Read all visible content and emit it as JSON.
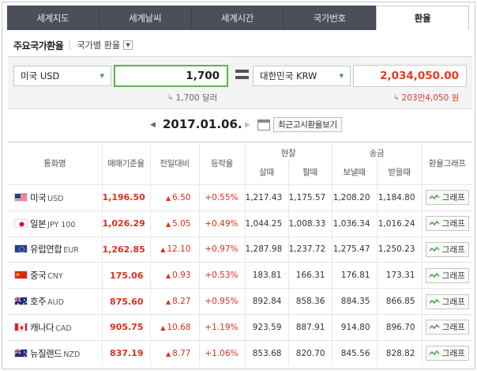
{
  "tabs": [
    {
      "label": "세계지도",
      "active": false
    },
    {
      "label": "세계날씨",
      "active": false
    },
    {
      "label": "세계시간",
      "active": false
    },
    {
      "label": "국가번호",
      "active": false
    },
    {
      "label": "환율",
      "active": true
    }
  ],
  "subtabs": {
    "active": "주요국가환율",
    "other": "국가별 환율"
  },
  "converter": {
    "from_currency": "미국 USD",
    "from_amount": "1,700",
    "from_hint": "1,700 달러",
    "to_currency": "대한민국 KRW",
    "to_amount": "2,034,050.00",
    "to_hint": "203만4,050 원"
  },
  "date": "2017.01.06.",
  "recent_button": "최근고시환율보기",
  "table": {
    "headers": {
      "currency": "통화명",
      "base": "매매기준율",
      "change": "전일대비",
      "rate": "등락율",
      "cash": "현찰",
      "cash_buy": "살때",
      "cash_sell": "팔때",
      "remit": "송금",
      "remit_send": "보낼때",
      "remit_recv": "받을때",
      "graph": "환율그래프"
    },
    "graph_label": "그래프",
    "rows": [
      {
        "name": "미국",
        "code": "USD",
        "flag": "us",
        "base": "1,196.50",
        "change": "6.50",
        "rate": "+0.55%",
        "cash_buy": "1,217.43",
        "cash_sell": "1,175.57",
        "send": "1,208.20",
        "recv": "1,184.80"
      },
      {
        "name": "일본",
        "code": "JPY 100",
        "flag": "jp",
        "base": "1,026.29",
        "change": "5.05",
        "rate": "+0.49%",
        "cash_buy": "1,044.25",
        "cash_sell": "1,008.33",
        "send": "1,036.34",
        "recv": "1,016.24"
      },
      {
        "name": "유럽연합",
        "code": "EUR",
        "flag": "eu",
        "base": "1,262.85",
        "change": "12.10",
        "rate": "+0.97%",
        "cash_buy": "1,287.98",
        "cash_sell": "1,237.72",
        "send": "1,275.47",
        "recv": "1,250.23"
      },
      {
        "name": "중국",
        "code": "CNY",
        "flag": "cn",
        "base": "175.06",
        "change": "0.93",
        "rate": "+0.53%",
        "cash_buy": "183.81",
        "cash_sell": "166.31",
        "send": "176.81",
        "recv": "173.31"
      },
      {
        "name": "호주",
        "code": "AUD",
        "flag": "au",
        "base": "875.60",
        "change": "8.27",
        "rate": "+0.95%",
        "cash_buy": "892.84",
        "cash_sell": "858.36",
        "send": "884.35",
        "recv": "866.85"
      },
      {
        "name": "캐나다",
        "code": "CAD",
        "flag": "ca",
        "base": "905.75",
        "change": "10.68",
        "rate": "+1.19%",
        "cash_buy": "923.59",
        "cash_sell": "887.91",
        "send": "914.80",
        "recv": "896.70"
      },
      {
        "name": "뉴질랜드",
        "code": "NZD",
        "flag": "nz",
        "base": "837.19",
        "change": "8.77",
        "rate": "+1.06%",
        "cash_buy": "853.68",
        "cash_sell": "820.70",
        "send": "845.56",
        "recv": "828.82"
      }
    ]
  },
  "colors": {
    "up": "#d9301a",
    "converted": "#e63b1e",
    "input_focus": "#5cb646",
    "tab_bar": "#4b4f58"
  }
}
